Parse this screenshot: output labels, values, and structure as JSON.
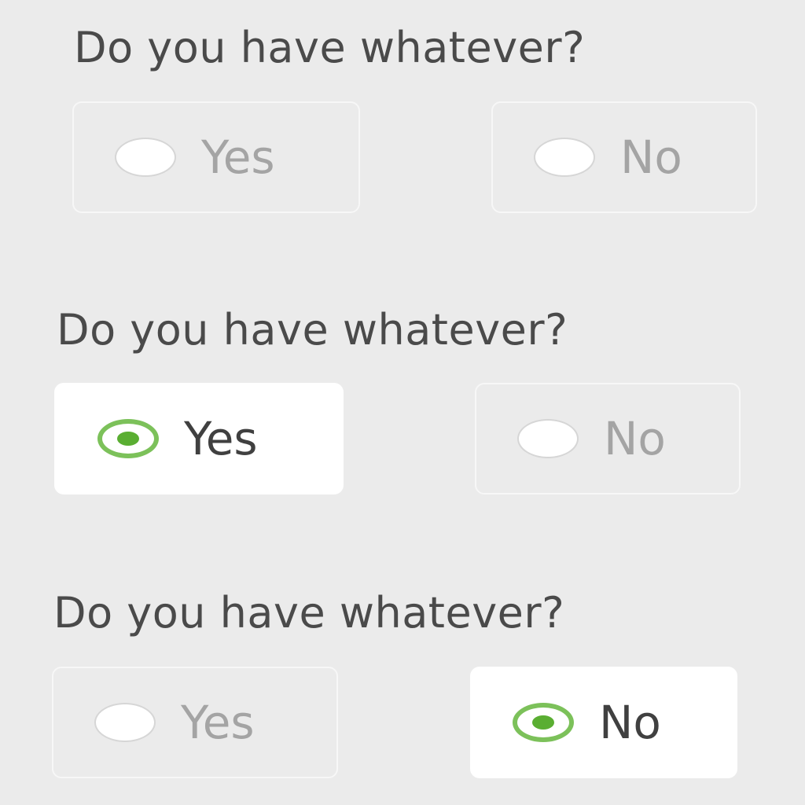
{
  "colors": {
    "background": "#ebebeb",
    "text": "#4a4a4a",
    "unselected_text": "#a4a4a4",
    "selected_bg": "#ffffff",
    "radio_accent": "#7cc15a"
  },
  "groups": [
    {
      "question": "Do you have whatever?",
      "selected": null,
      "options": [
        {
          "label": "Yes",
          "selected": false
        },
        {
          "label": "No",
          "selected": false
        }
      ]
    },
    {
      "question": "Do you have whatever?",
      "selected": "Yes",
      "options": [
        {
          "label": "Yes",
          "selected": true
        },
        {
          "label": "No",
          "selected": false
        }
      ]
    },
    {
      "question": "Do you have whatever?",
      "selected": "No",
      "options": [
        {
          "label": "Yes",
          "selected": false
        },
        {
          "label": "No",
          "selected": true
        }
      ]
    }
  ]
}
